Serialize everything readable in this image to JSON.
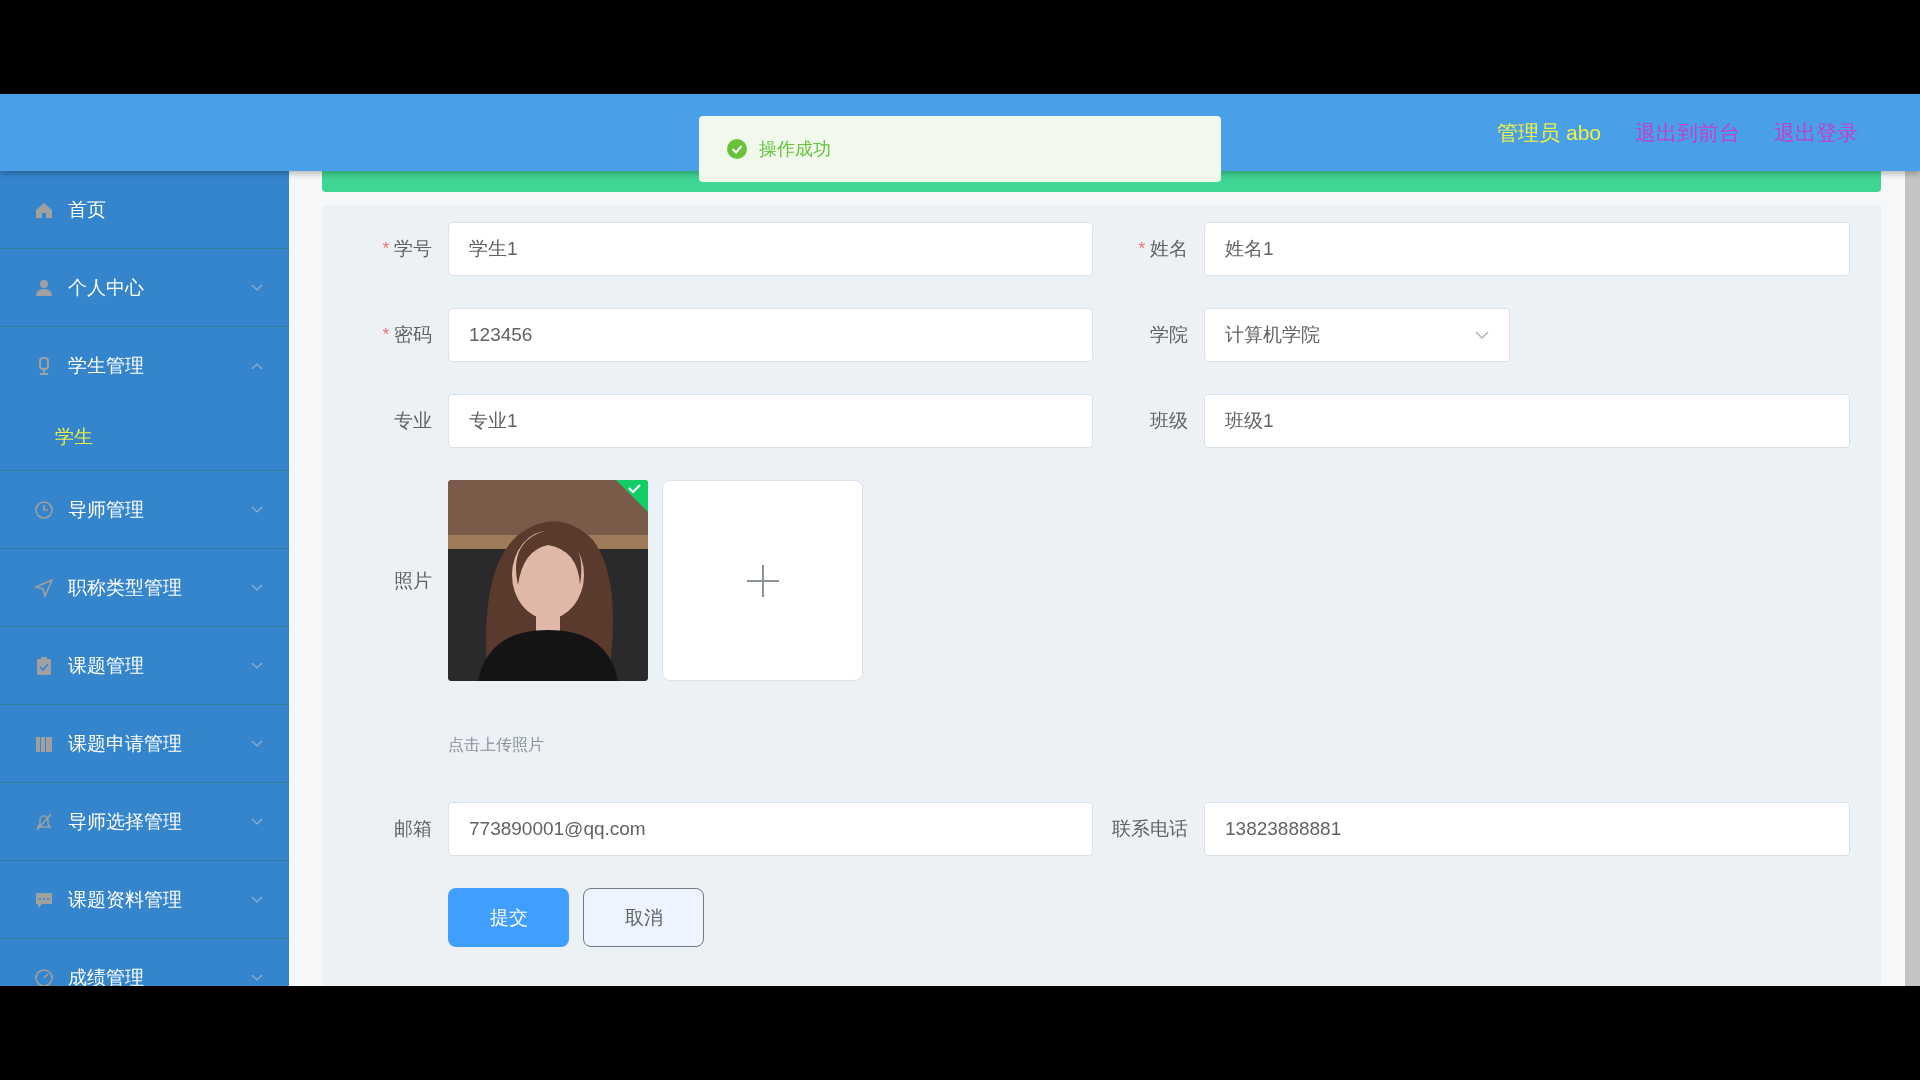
{
  "header": {
    "user": "管理员 abo",
    "links": [
      "退出到前台",
      "退出登录"
    ]
  },
  "toast": {
    "message": "操作成功"
  },
  "sidebar": {
    "items": [
      {
        "label": "首页"
      },
      {
        "label": "个人中心",
        "expanded": false
      },
      {
        "label": "学生管理",
        "expanded": true,
        "children": [
          {
            "label": "学生",
            "selected": true
          }
        ]
      },
      {
        "label": "导师管理",
        "expanded": false
      },
      {
        "label": "职称类型管理",
        "expanded": false
      },
      {
        "label": "课题管理",
        "expanded": false
      },
      {
        "label": "课题申请管理",
        "expanded": false
      },
      {
        "label": "导师选择管理",
        "expanded": false
      },
      {
        "label": "课题资料管理",
        "expanded": false
      },
      {
        "label": "成绩管理",
        "expanded": false
      }
    ]
  },
  "form": {
    "fields": [
      {
        "kind": "text",
        "required_mark": "*",
        "label": "学号",
        "value": "学生1"
      },
      {
        "kind": "text",
        "required_mark": "*",
        "label": "姓名",
        "value": "姓名1"
      },
      {
        "kind": "text",
        "required_mark": "*",
        "label": "密码",
        "value": "123456"
      },
      {
        "kind": "select",
        "label": "学院",
        "value": "计算机学院"
      },
      {
        "kind": "text",
        "label": "专业",
        "value": "专业1"
      },
      {
        "kind": "text",
        "label": "班级",
        "value": "班级1"
      },
      {
        "kind": "upload",
        "label": "照片",
        "hint": "点击上传照片",
        "uploaded": true
      },
      {
        "kind": "text",
        "label": "邮箱",
        "value": "773890001@qq.com"
      },
      {
        "kind": "text",
        "label": "联系电话",
        "value": "13823888881"
      }
    ],
    "buttons": [
      {
        "label": "提交",
        "kind": "primary"
      },
      {
        "label": "取消",
        "kind": "default"
      }
    ]
  }
}
